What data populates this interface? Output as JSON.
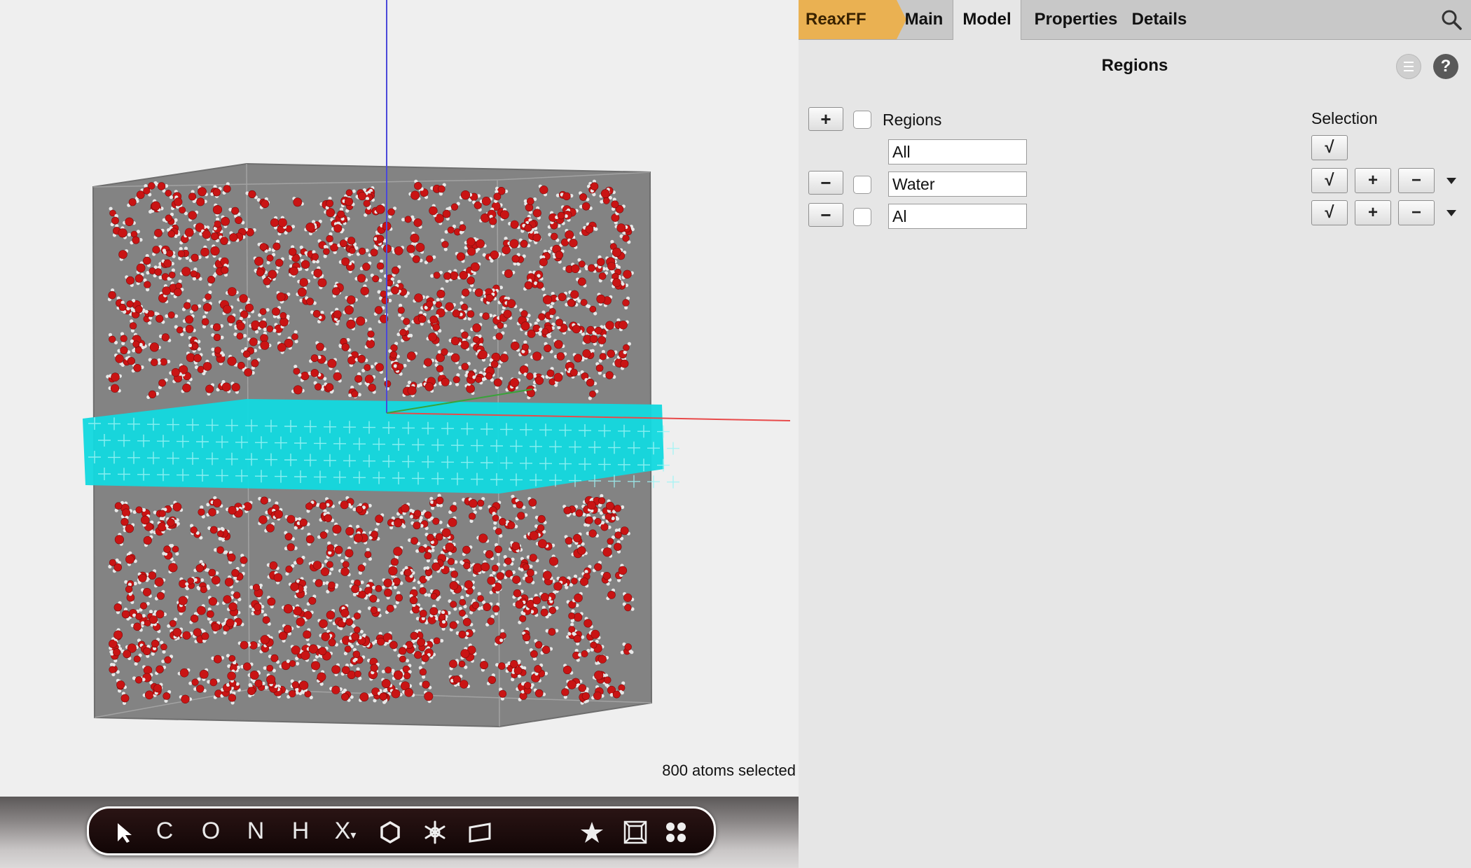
{
  "viewer": {
    "status_text": "800 atoms selected"
  },
  "toolbar": {
    "tools": [
      {
        "name": "select-tool",
        "label": ""
      },
      {
        "name": "carbon-tool",
        "label": "C"
      },
      {
        "name": "oxygen-tool",
        "label": "O"
      },
      {
        "name": "nitrogen-tool",
        "label": "N"
      },
      {
        "name": "hydrogen-tool",
        "label": "H"
      },
      {
        "name": "other-element-tool",
        "label": "X"
      }
    ],
    "icons": [
      "cursor-icon",
      "ring-icon",
      "snowflake-icon",
      "plane-icon",
      "star-icon",
      "box-icon",
      "molecules-icon"
    ]
  },
  "tabs": {
    "reaxff": "ReaxFF",
    "main": "Main",
    "model": "Model",
    "properties": "Properties",
    "details": "Details",
    "active": "Model"
  },
  "panel": {
    "title": "Regions",
    "help_label": "?",
    "regions_header": "Regions",
    "selection_header": "Selection",
    "add_symbol": "+",
    "remove_symbol": "−",
    "check_symbol": "√",
    "regions": [
      {
        "name": "All",
        "removable": false
      },
      {
        "name": "Water",
        "removable": true
      },
      {
        "name": "Al",
        "removable": true
      }
    ]
  },
  "colors": {
    "reaxff_tab": "#eab152",
    "slab": "#00d7df",
    "oxygen": "#c91414",
    "hydrogen": "#e8e8e8",
    "box": "#808080"
  }
}
